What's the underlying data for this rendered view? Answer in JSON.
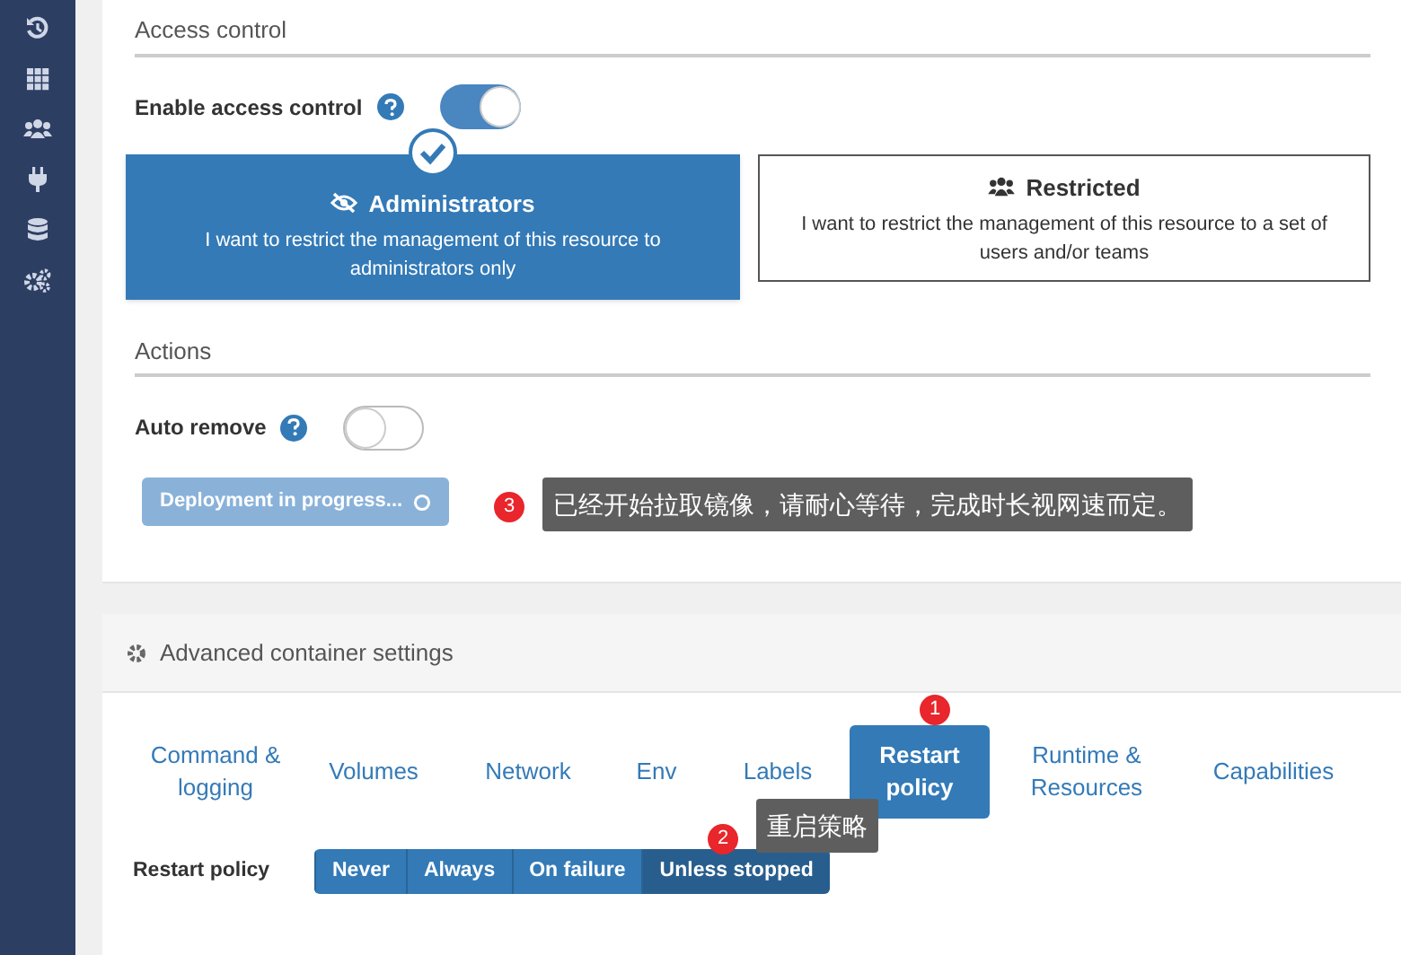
{
  "access_control": {
    "heading": "Access control",
    "enable": {
      "label": "Enable access control",
      "on": true
    },
    "options": [
      {
        "title": "Administrators",
        "description": "I want to restrict the management of this resource to administrators only",
        "selected": true
      },
      {
        "title": "Restricted",
        "description": "I want to restrict the management of this resource to a set of users and/or teams",
        "selected": false
      }
    ]
  },
  "actions": {
    "heading": "Actions",
    "auto_remove": {
      "label": "Auto remove",
      "on": false
    },
    "deploy_button": {
      "label": "Deployment in progress...",
      "disabled": true
    }
  },
  "advanced": {
    "title": "Advanced container settings",
    "tabs": [
      {
        "label": "Command & logging",
        "selected": false
      },
      {
        "label": "Volumes",
        "selected": false
      },
      {
        "label": "Network",
        "selected": false
      },
      {
        "label": "Env",
        "selected": false
      },
      {
        "label": "Labels",
        "selected": false
      },
      {
        "label": "Restart policy",
        "selected": true
      },
      {
        "label": "Runtime & Resources",
        "selected": false
      },
      {
        "label": "Capabilities",
        "selected": false
      }
    ],
    "restart_policy": {
      "label": "Restart policy",
      "options": [
        {
          "label": "Never",
          "selected": false
        },
        {
          "label": "Always",
          "selected": false
        },
        {
          "label": "On failure",
          "selected": false
        },
        {
          "label": "Unless stopped",
          "selected": true
        }
      ]
    }
  },
  "annotations": [
    {
      "number": "3",
      "text": "已经开始拉取镜像，请耐心等待，完成时长视网速而定。"
    },
    {
      "number": "1"
    },
    {
      "number": "2",
      "text": "重启策略"
    }
  ]
}
